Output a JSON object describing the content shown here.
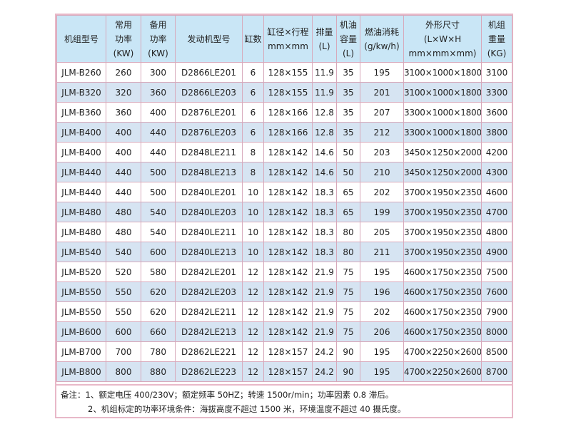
{
  "headers": [
    [
      "机组型号"
    ],
    [
      "常用",
      "功率",
      "(KW)"
    ],
    [
      "备用",
      "功率",
      "(KW)"
    ],
    [
      "发动机型号"
    ],
    [
      "缸数"
    ],
    [
      "缸径×行程",
      "mm×mm"
    ],
    [
      "排量",
      "(L)"
    ],
    [
      "机油",
      "容量",
      "(L)"
    ],
    [
      "燃油消耗",
      "(g/kw/h)"
    ],
    [
      "外形尺寸",
      "(L×W×H",
      "mm×mm×mm)"
    ],
    [
      "机组",
      "重量",
      "(KG)"
    ]
  ],
  "rows": [
    [
      "JLM-B260",
      "260",
      "300",
      "D2866LE201",
      "6",
      "128×155",
      "11.9",
      "35",
      "195",
      "3100×1000×1800",
      "3100"
    ],
    [
      "JLM-B320",
      "320",
      "360",
      "D2866LE203",
      "6",
      "128×155",
      "11.9",
      "35",
      "201",
      "3100×1000×1800",
      "3300"
    ],
    [
      "JLM-B360",
      "360",
      "400",
      "D2876LE201",
      "6",
      "128×166",
      "12.8",
      "35",
      "207",
      "3300×1000×1800",
      "3600"
    ],
    [
      "JLM-B400",
      "400",
      "440",
      "D2876LE203",
      "6",
      "128×166",
      "12.8",
      "35",
      "212",
      "3300×1000×1800",
      "3800"
    ],
    [
      "JLM-B400",
      "400",
      "440",
      "D2848LE211",
      "8",
      "128×142",
      "14.6",
      "50",
      "203",
      "3450×1250×2000",
      "4200"
    ],
    [
      "JLM-B440",
      "440",
      "500",
      "D2848LE213",
      "8",
      "128×142",
      "14.6",
      "50",
      "210",
      "3450×1250×2000",
      "4300"
    ],
    [
      "JLM-B440",
      "440",
      "500",
      "D2840LE201",
      "10",
      "128×142",
      "18.3",
      "65",
      "202",
      "3700×1950×2350",
      "4600"
    ],
    [
      "JLM-B480",
      "480",
      "540",
      "D2840LE203",
      "10",
      "128×142",
      "18.3",
      "65",
      "199",
      "3700×1950×2350",
      "4700"
    ],
    [
      "JLM-B480",
      "480",
      "540",
      "D2840LE211",
      "10",
      "128×142",
      "18.3",
      "80",
      "205",
      "3700×1950×2350",
      "4800"
    ],
    [
      "JLM-B540",
      "540",
      "600",
      "D2840LE213",
      "10",
      "128×142",
      "18.3",
      "80",
      "211",
      "3700×1950×2350",
      "4900"
    ],
    [
      "JLM-B520",
      "520",
      "580",
      "D2842LE201",
      "12",
      "128×142",
      "21.9",
      "75",
      "195",
      "4600×1750×2350",
      "7500"
    ],
    [
      "JLM-B550",
      "550",
      "620",
      "D2842LE203",
      "12",
      "128×142",
      "21.9",
      "75",
      "196",
      "4600×1750×2350",
      "7600"
    ],
    [
      "JLM-B550",
      "550",
      "620",
      "D2842LE211",
      "12",
      "128×142",
      "21.9",
      "75",
      "202",
      "4600×1750×2350",
      "7900"
    ],
    [
      "JLM-B600",
      "600",
      "660",
      "D2842LE213",
      "12",
      "128×142",
      "21.9",
      "75",
      "206",
      "4600×1750×2350",
      "8000"
    ],
    [
      "JLM-B700",
      "700",
      "780",
      "D2862LE221",
      "12",
      "128×157",
      "24.2",
      "90",
      "195",
      "4700×2250×2600",
      "8500"
    ],
    [
      "JLM-B800",
      "800",
      "880",
      "D2862LE223",
      "12",
      "128×157",
      "24.2",
      "90",
      "195",
      "4700×2250×2600",
      "8700"
    ]
  ],
  "note": {
    "line1": "备注：1、额定电压 400/230V；额定频率 50HZ；转速 1500r/min；功率因素 0.8 滞后。",
    "line2": "2、机组标定的功率环境条件：海拔高度不超过 1500 米，环境温度不超过 40 摄氏度。"
  }
}
